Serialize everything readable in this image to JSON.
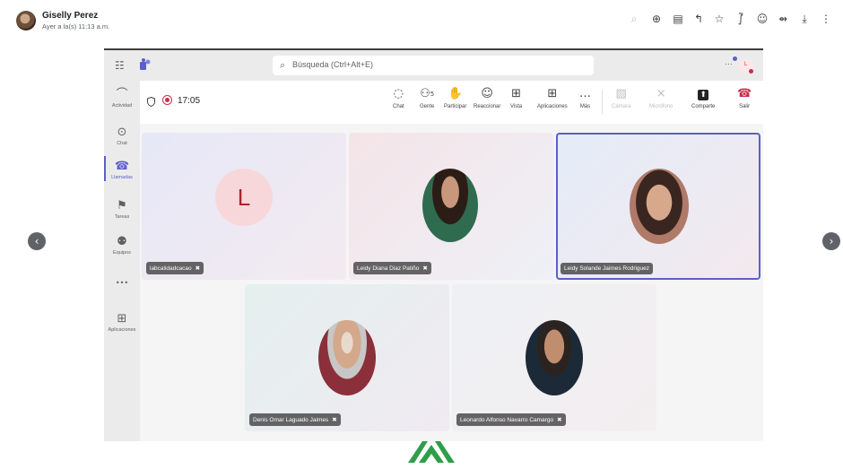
{
  "viewer": {
    "sender_name": "Giselly Perez",
    "sender_time": "Ayer a la(s) 11:13 a.m.",
    "icons": [
      "zoom-out-icon",
      "zoom-in-icon",
      "caption-icon",
      "reply-icon",
      "star-icon",
      "pin-icon",
      "emoji-icon",
      "forward-icon",
      "download-icon",
      "more-vert-icon"
    ],
    "icon_glyphs": [
      "⌕",
      "⊕",
      "▤",
      "↰",
      "☆",
      "⨛",
      "☺",
      "⇴",
      "⤓",
      "⋮"
    ],
    "prev_glyph": "‹",
    "next_glyph": "›"
  },
  "teams": {
    "search_placeholder": "Búsqueda (Ctrl+Alt+E)",
    "sidebar": [
      {
        "label": "Actividad",
        "icon": "bell-icon",
        "glyph": "⌒"
      },
      {
        "label": "Chat",
        "icon": "chat-icon",
        "glyph": "⊙"
      },
      {
        "label": "Llamadas",
        "icon": "phone-icon",
        "glyph": "☎"
      },
      {
        "label": "Tareas",
        "icon": "tasks-icon",
        "glyph": "⚑"
      },
      {
        "label": "Equipos",
        "icon": "teams-icon",
        "glyph": "⚉"
      },
      {
        "label": "",
        "icon": "more-icon",
        "glyph": "•••"
      },
      {
        "label": "Aplicaciones",
        "icon": "apps-icon",
        "glyph": "⊞"
      }
    ],
    "call_timer": "17:05",
    "people_count": "5",
    "toolbar": [
      {
        "label": "Chat",
        "glyph": "◌"
      },
      {
        "label": "Gente",
        "glyph": "⚇"
      },
      {
        "label": "Participar",
        "glyph": "✋"
      },
      {
        "label": "Reaccionar",
        "glyph": "☺"
      },
      {
        "label": "Vista",
        "glyph": "⊞"
      },
      {
        "label": "Aplicaciones",
        "glyph": "⊞"
      },
      {
        "label": "Más",
        "glyph": "…"
      },
      {
        "label": "Cámara",
        "glyph": "▨"
      },
      {
        "label": "Micrófono",
        "glyph": "⨯"
      },
      {
        "label": "Comparte",
        "glyph": "⬆"
      },
      {
        "label": "Salir",
        "glyph": "☎"
      }
    ],
    "participants": [
      {
        "name": "labcalidadcacao",
        "initial": "L"
      },
      {
        "name": "Leidy Diana Diaz Patiño"
      },
      {
        "name": "Leidy Solande Jaimes Rodriguez"
      },
      {
        "name": "Denis Omar Laguado Jaimes"
      },
      {
        "name": "Leonardo Alfonso Navarro Camargo"
      }
    ],
    "mic_off_glyph": "✖",
    "colors": {
      "accent": "#5b5fc7",
      "leave": "#c4314b",
      "active_speaker_border": "#5b5fc7"
    }
  }
}
